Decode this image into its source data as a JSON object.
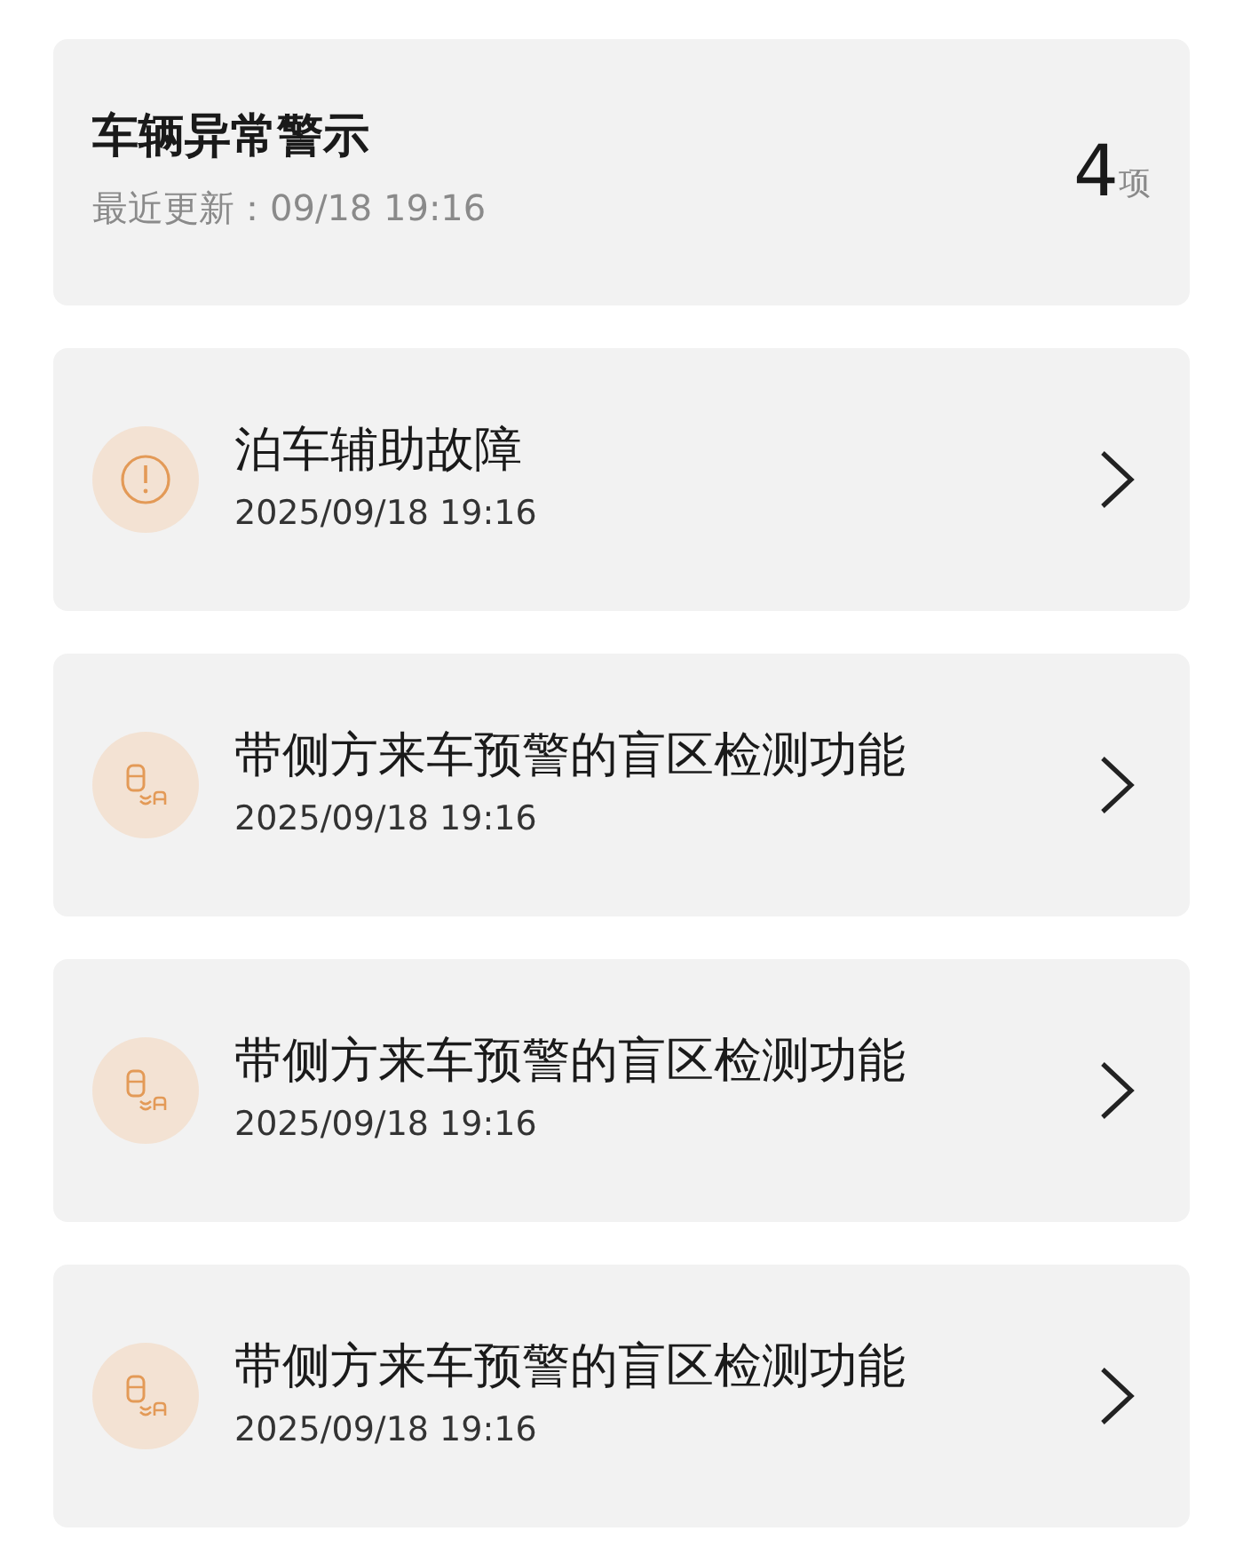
{
  "header": {
    "title": "车辆异常警示",
    "updated": "最近更新：09/18 19:16",
    "count": "4",
    "count_unit": "项"
  },
  "alerts": [
    {
      "kind": "warning",
      "title": "泊车辅助故障",
      "time": "2025/09/18 19:16"
    },
    {
      "kind": "blind-spot",
      "title": "带侧方来车预警的盲区检测功能",
      "time": "2025/09/18 19:16"
    },
    {
      "kind": "blind-spot",
      "title": "带侧方来车预警的盲区检测功能",
      "time": "2025/09/18 19:16"
    },
    {
      "kind": "blind-spot",
      "title": "带侧方来车预警的盲区检测功能",
      "time": "2025/09/18 19:16"
    }
  ]
}
